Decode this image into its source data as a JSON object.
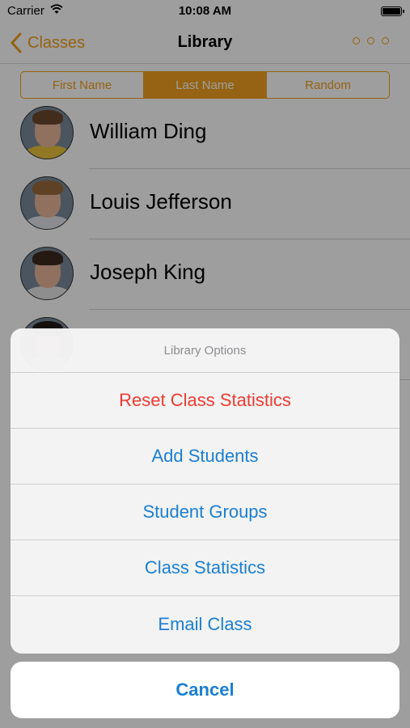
{
  "status_bar": {
    "carrier": "Carrier",
    "time": "10:08 AM"
  },
  "nav_bar": {
    "back_label": "Classes",
    "title": "Library",
    "more_icon": "ellipsis-icon"
  },
  "sort_control": {
    "segments": [
      "First Name",
      "Last Name",
      "Random"
    ],
    "selected": "Last Name"
  },
  "students": [
    {
      "name": "William Ding"
    },
    {
      "name": "Louis Jefferson"
    },
    {
      "name": "Joseph King"
    }
  ],
  "action_sheet": {
    "title": "Library Options",
    "options": [
      {
        "label": "Reset Class Statistics",
        "style": "destructive"
      },
      {
        "label": "Add Students",
        "style": "default"
      },
      {
        "label": "Student Groups",
        "style": "default"
      },
      {
        "label": "Class Statistics",
        "style": "default"
      },
      {
        "label": "Email Class",
        "style": "default"
      }
    ],
    "cancel_label": "Cancel"
  },
  "colors": {
    "accent": "#f0a020",
    "action_blue": "#1a7fd4",
    "destructive_red": "#f03a32"
  }
}
